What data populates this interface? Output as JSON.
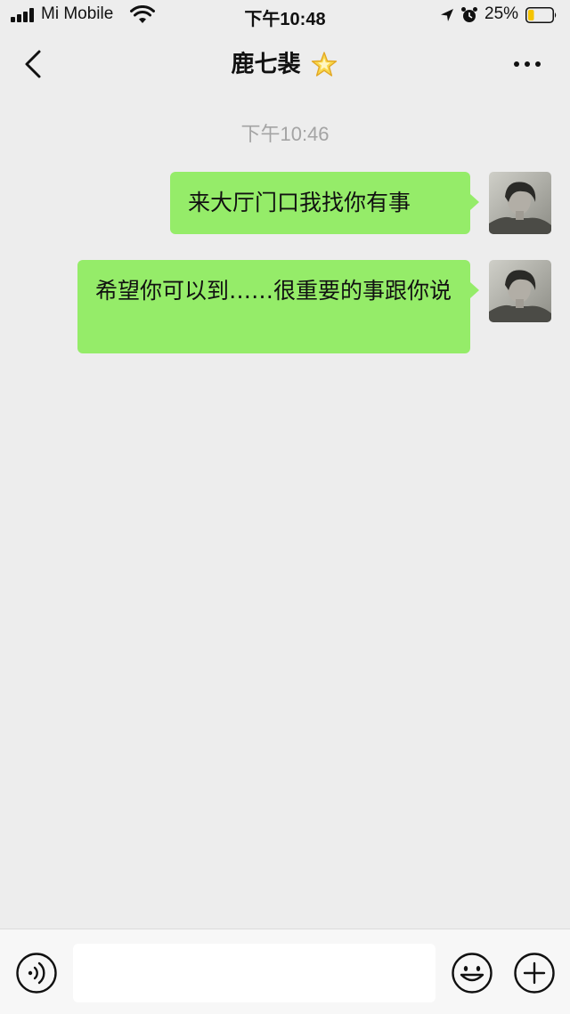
{
  "status_bar": {
    "carrier": "Mi Mobile",
    "time": "下午10:48",
    "battery_percent": "25%",
    "battery_level": 0.25,
    "icons": [
      "signal-icon",
      "wifi-icon",
      "location-icon",
      "alarm-icon",
      "battery-icon"
    ]
  },
  "nav": {
    "back_icon": "chevron-left-icon",
    "title": "鹿七裴",
    "title_icon": "star-icon",
    "more_icon": "more-dots-icon"
  },
  "chat": {
    "timestamp": "下午10:46",
    "messages": [
      {
        "sender": "self",
        "text": "来大厅门口我找你有事"
      },
      {
        "sender": "self",
        "text": "希望你可以到……很重要的事跟你说"
      }
    ]
  },
  "input_bar": {
    "voice_icon": "voice-icon",
    "input_value": "",
    "emoji_icon": "emoji-icon",
    "plus_icon": "plus-icon"
  },
  "colors": {
    "background": "#ededed",
    "bubble_self": "#95ec69",
    "timestamp": "#a4a4a4",
    "battery_fill": "#f5c400"
  }
}
